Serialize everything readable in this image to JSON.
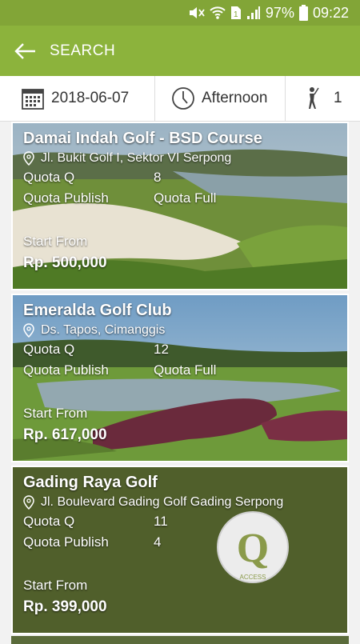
{
  "status": {
    "battery": "97%",
    "time": "09:22"
  },
  "appbar": {
    "title": "SEARCH"
  },
  "filters": {
    "date": "2018-06-07",
    "time": "Afternoon",
    "players": "1"
  },
  "cards": [
    {
      "name": "Damai Indah Golf - BSD Course",
      "address": "Jl. Bukit Golf I, Sektor VI Serpong",
      "quota_q_label": "Quota Q",
      "quota_q": "8",
      "quota_publish_label": "Quota Publish",
      "quota_publish": "Quota Full",
      "start_from": "Start From",
      "price": "Rp. 500,000"
    },
    {
      "name": "Emeralda Golf Club",
      "address": "Ds. Tapos, Cimanggis",
      "quota_q_label": "Quota Q",
      "quota_q": "12",
      "quota_publish_label": "Quota Publish",
      "quota_publish": "Quota Full",
      "start_from": "Start From",
      "price": "Rp. 617,000"
    },
    {
      "name": "Gading Raya Golf",
      "address": "Jl. Boulevard Gading Golf Gading Serpong",
      "quota_q_label": "Quota Q",
      "quota_q": "11",
      "quota_publish_label": "Quota Publish",
      "quota_publish": "4",
      "start_from": "Start From",
      "price": "Rp. 399,000"
    }
  ],
  "logo": {
    "letter": "Q",
    "caption": "ACCESS"
  },
  "colors": {
    "appbar": "#8cb33c",
    "statusbar": "#82a537"
  }
}
